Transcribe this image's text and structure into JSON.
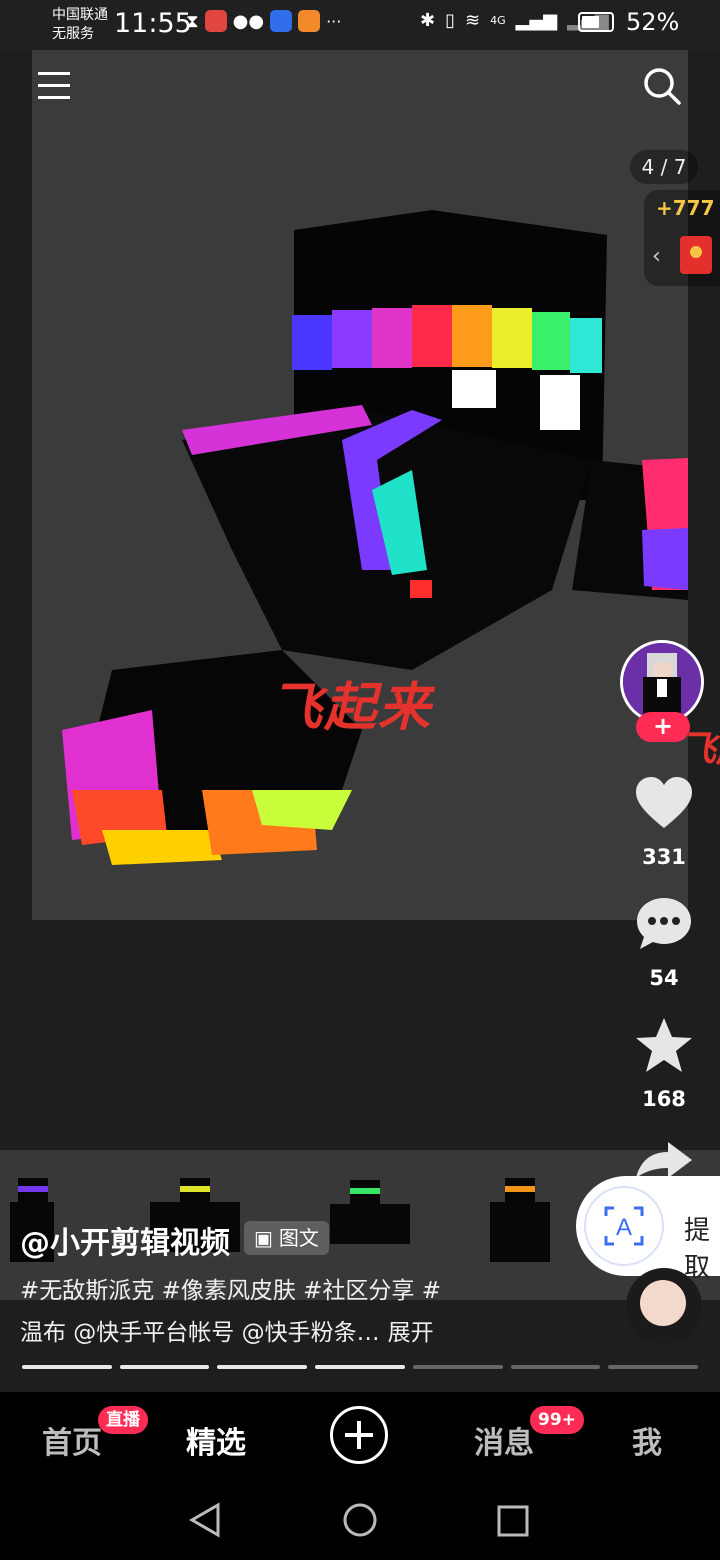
{
  "status_bar": {
    "carrier_line1": "中国联通",
    "carrier_line2": "无服务",
    "time": "11:55",
    "signal_4g": "4G",
    "battery_percent": "52%",
    "battery_level": 0.52,
    "more": "···"
  },
  "post": {
    "page_indicator": "4 / 7",
    "reward": "+777",
    "overlay_caption": "飞起来",
    "side_caption": "飞起",
    "author": "@小开剪辑视频",
    "type_tag": "图文",
    "description_line1": "#无敌斯派克 #像素风皮肤 #社区分享 #",
    "description_line2": "温布 @快手平台帐号 @快手粉条…",
    "expand_label": "展开",
    "total_pages": 7,
    "current_page": 4
  },
  "actions": {
    "follow": "+",
    "likes": "331",
    "comments": "54",
    "favorites": "168"
  },
  "extract": {
    "label": "提取"
  },
  "tabs": [
    {
      "label": "首页",
      "badge": "直播"
    },
    {
      "label": "精选"
    },
    {
      "label": "消息",
      "badge": "99+"
    },
    {
      "label": "我"
    }
  ],
  "colors": {
    "accent_red": "#fe2c55",
    "caption_red": "#e5322d",
    "reward_gold": "#f6c545"
  }
}
